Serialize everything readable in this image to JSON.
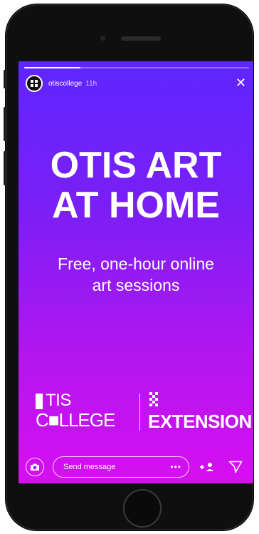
{
  "story": {
    "progress": 0.25,
    "header": {
      "username": "otiscollege",
      "time": "11h",
      "close_icon": "close-icon",
      "avatar_icon": "otis-avatar-logo"
    },
    "headline": {
      "line1": "OTIS ART",
      "line2": "AT HOME"
    },
    "subtitle": {
      "line1": "Free, one-hour online",
      "line2": "art sessions"
    },
    "logo": {
      "tis": "TIS",
      "college": "C■LLEGE",
      "extension": "EXTENSION"
    },
    "reply_bar": {
      "placeholder": "Send message",
      "more": "•••",
      "camera_icon": "camera-icon",
      "add_user_icon": "add-user-icon",
      "send_icon": "send-icon"
    }
  },
  "colors": {
    "gradient_top": "#5f26ff",
    "gradient_bottom": "#d60ff0",
    "phone_body": "#0f0f10",
    "text": "#ffffff"
  }
}
